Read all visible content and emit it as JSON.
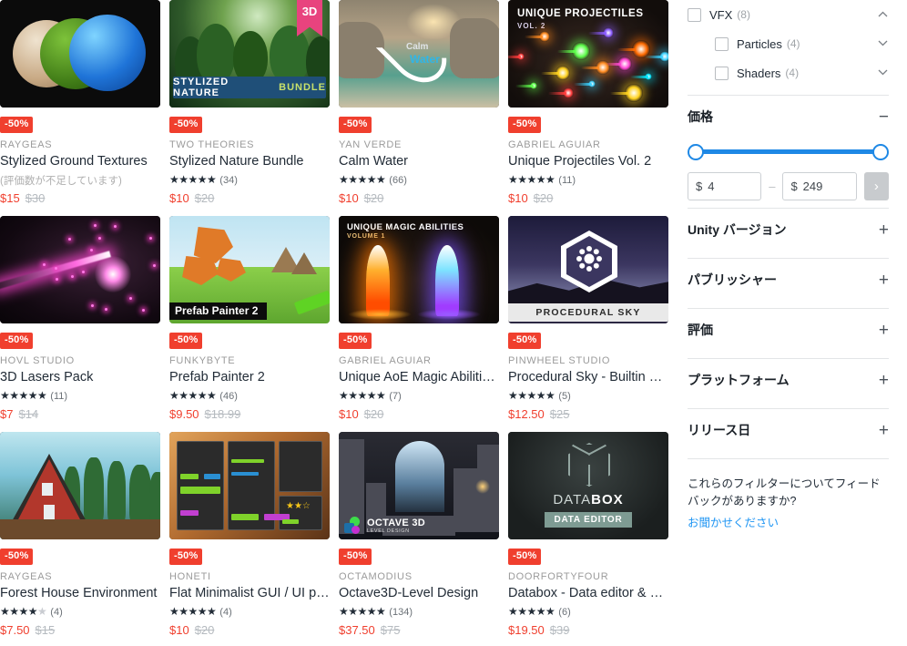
{
  "products": [
    {
      "id": "stylized-ground-textures",
      "discount": "-50%",
      "publisher": "RAYGEAS",
      "title": "Stylized Ground Textures",
      "rating_text": "(評価数が不足しています)",
      "stars": 0,
      "review_count": "",
      "price_now": "$15",
      "price_was": "$30",
      "badge_3d": "",
      "thumb": "ground-textures"
    },
    {
      "id": "stylized-nature-bundle",
      "discount": "-50%",
      "publisher": "TWO THEORIES",
      "title": "Stylized Nature Bundle",
      "rating_text": "",
      "stars": 5,
      "review_count": "(34)",
      "price_now": "$10",
      "price_was": "$20",
      "badge_3d": "3D",
      "thumb": "nature-bundle",
      "thumb_caption": "STYLIZED NATURE",
      "thumb_caption_hl": "BUNDLE"
    },
    {
      "id": "calm-water",
      "discount": "-50%",
      "publisher": "YAN VERDE",
      "title": "Calm Water",
      "rating_text": "",
      "stars": 5,
      "review_count": "(66)",
      "price_now": "$10",
      "price_was": "$20",
      "badge_3d": "",
      "thumb": "calm-water",
      "thumb_caption": "Calm",
      "thumb_caption_hl": "Water"
    },
    {
      "id": "unique-projectiles-vol-2",
      "discount": "-50%",
      "publisher": "GABRIEL AGUIAR",
      "title": "Unique Projectiles Vol. 2",
      "rating_text": "",
      "stars": 5,
      "review_count": "(11)",
      "price_now": "$10",
      "price_was": "$20",
      "badge_3d": "",
      "thumb": "projectiles",
      "thumb_caption": "UNIQUE PROJECTILES",
      "thumb_caption_hl": "VOL. 2"
    },
    {
      "id": "3d-lasers-pack",
      "discount": "-50%",
      "publisher": "HOVL STUDIO",
      "title": "3D Lasers Pack",
      "rating_text": "",
      "stars": 5,
      "review_count": "(11)",
      "price_now": "$7",
      "price_was": "$14",
      "badge_3d": "",
      "thumb": "lasers"
    },
    {
      "id": "prefab-painter-2",
      "discount": "-50%",
      "publisher": "FUNKYBYTE",
      "title": "Prefab Painter 2",
      "rating_text": "",
      "stars": 5,
      "review_count": "(46)",
      "price_now": "$9.50",
      "price_was": "$18.99",
      "badge_3d": "",
      "thumb": "prefab-painter",
      "thumb_caption": "Prefab Painter 2"
    },
    {
      "id": "unique-aoe-magic-abilities",
      "discount": "-50%",
      "publisher": "GABRIEL AGUIAR",
      "title": "Unique AoE Magic Abilities...",
      "rating_text": "",
      "stars": 5,
      "review_count": "(7)",
      "price_now": "$10",
      "price_was": "$20",
      "badge_3d": "",
      "thumb": "aoe-magic",
      "thumb_caption": "UNIQUE MAGIC ABILITIES",
      "thumb_caption_hl": "VOLUME 1"
    },
    {
      "id": "procedural-sky",
      "discount": "-50%",
      "publisher": "PINWHEEL STUDIO",
      "title": "Procedural Sky - Builtin & ...",
      "rating_text": "",
      "stars": 5,
      "review_count": "(5)",
      "price_now": "$12.50",
      "price_was": "$25",
      "badge_3d": "",
      "thumb": "procedural-sky",
      "thumb_caption": "PROCEDURAL SKY"
    },
    {
      "id": "forest-house-environment",
      "discount": "-50%",
      "publisher": "RAYGEAS",
      "title": "Forest House Environment",
      "rating_text": "",
      "stars": 4,
      "review_count": "(4)",
      "price_now": "$7.50",
      "price_was": "$15",
      "badge_3d": "",
      "thumb": "forest-house"
    },
    {
      "id": "flat-minimalist-gui",
      "discount": "-50%",
      "publisher": "HONETI",
      "title": "Flat Minimalist GUI / UI pa...",
      "rating_text": "",
      "stars": 5,
      "review_count": "(4)",
      "price_now": "$10",
      "price_was": "$20",
      "badge_3d": "",
      "thumb": "flat-gui"
    },
    {
      "id": "octave3d-level-design",
      "discount": "-50%",
      "publisher": "OCTAMODIUS",
      "title": "Octave3D-Level Design",
      "rating_text": "",
      "stars": 5,
      "review_count": "(134)",
      "price_now": "$37.50",
      "price_was": "$75",
      "badge_3d": "",
      "thumb": "octave3d",
      "thumb_caption": "OCTAVE 3D",
      "thumb_caption_hl": "LEVEL DESIGN"
    },
    {
      "id": "databox-data-editor",
      "discount": "-50%",
      "publisher": "DOORFORTYFOUR",
      "title": "Databox - Data editor & sa...",
      "rating_text": "",
      "stars": 5,
      "review_count": "(6)",
      "price_now": "$19.50",
      "price_was": "$39",
      "badge_3d": "",
      "thumb": "databox",
      "thumb_caption": "DATABOX",
      "thumb_caption_hl": "DATA EDITOR"
    }
  ],
  "sidebar": {
    "facets": [
      {
        "label": "VFX",
        "count": "(8)",
        "indent": false,
        "chevron": "up",
        "checked": false
      },
      {
        "label": "Particles",
        "count": "(4)",
        "indent": true,
        "chevron": "down",
        "checked": false
      },
      {
        "label": "Shaders",
        "count": "(4)",
        "indent": true,
        "chevron": "down",
        "checked": false
      }
    ],
    "price": {
      "title": "価格",
      "sign": "−",
      "currency": "$",
      "min_value": "4",
      "max_value": "249",
      "dash": "–",
      "go_label": "›"
    },
    "sections": [
      {
        "label": "Unity バージョン",
        "sign": "+"
      },
      {
        "label": "パブリッシャー",
        "sign": "+"
      },
      {
        "label": "評価",
        "sign": "+"
      },
      {
        "label": "プラットフォーム",
        "sign": "+"
      },
      {
        "label": "リリース日",
        "sign": "+"
      }
    ],
    "feedback": {
      "text": "これらのフィルターについてフィードバックがありますか?",
      "link": "お聞かせください"
    }
  },
  "colors": {
    "discount_red": "#f03f2e",
    "price_red": "#f03f2e",
    "accent_blue": "#1e88e5",
    "link_blue": "#2196f3",
    "ribbon_pink": "#e8437e"
  }
}
